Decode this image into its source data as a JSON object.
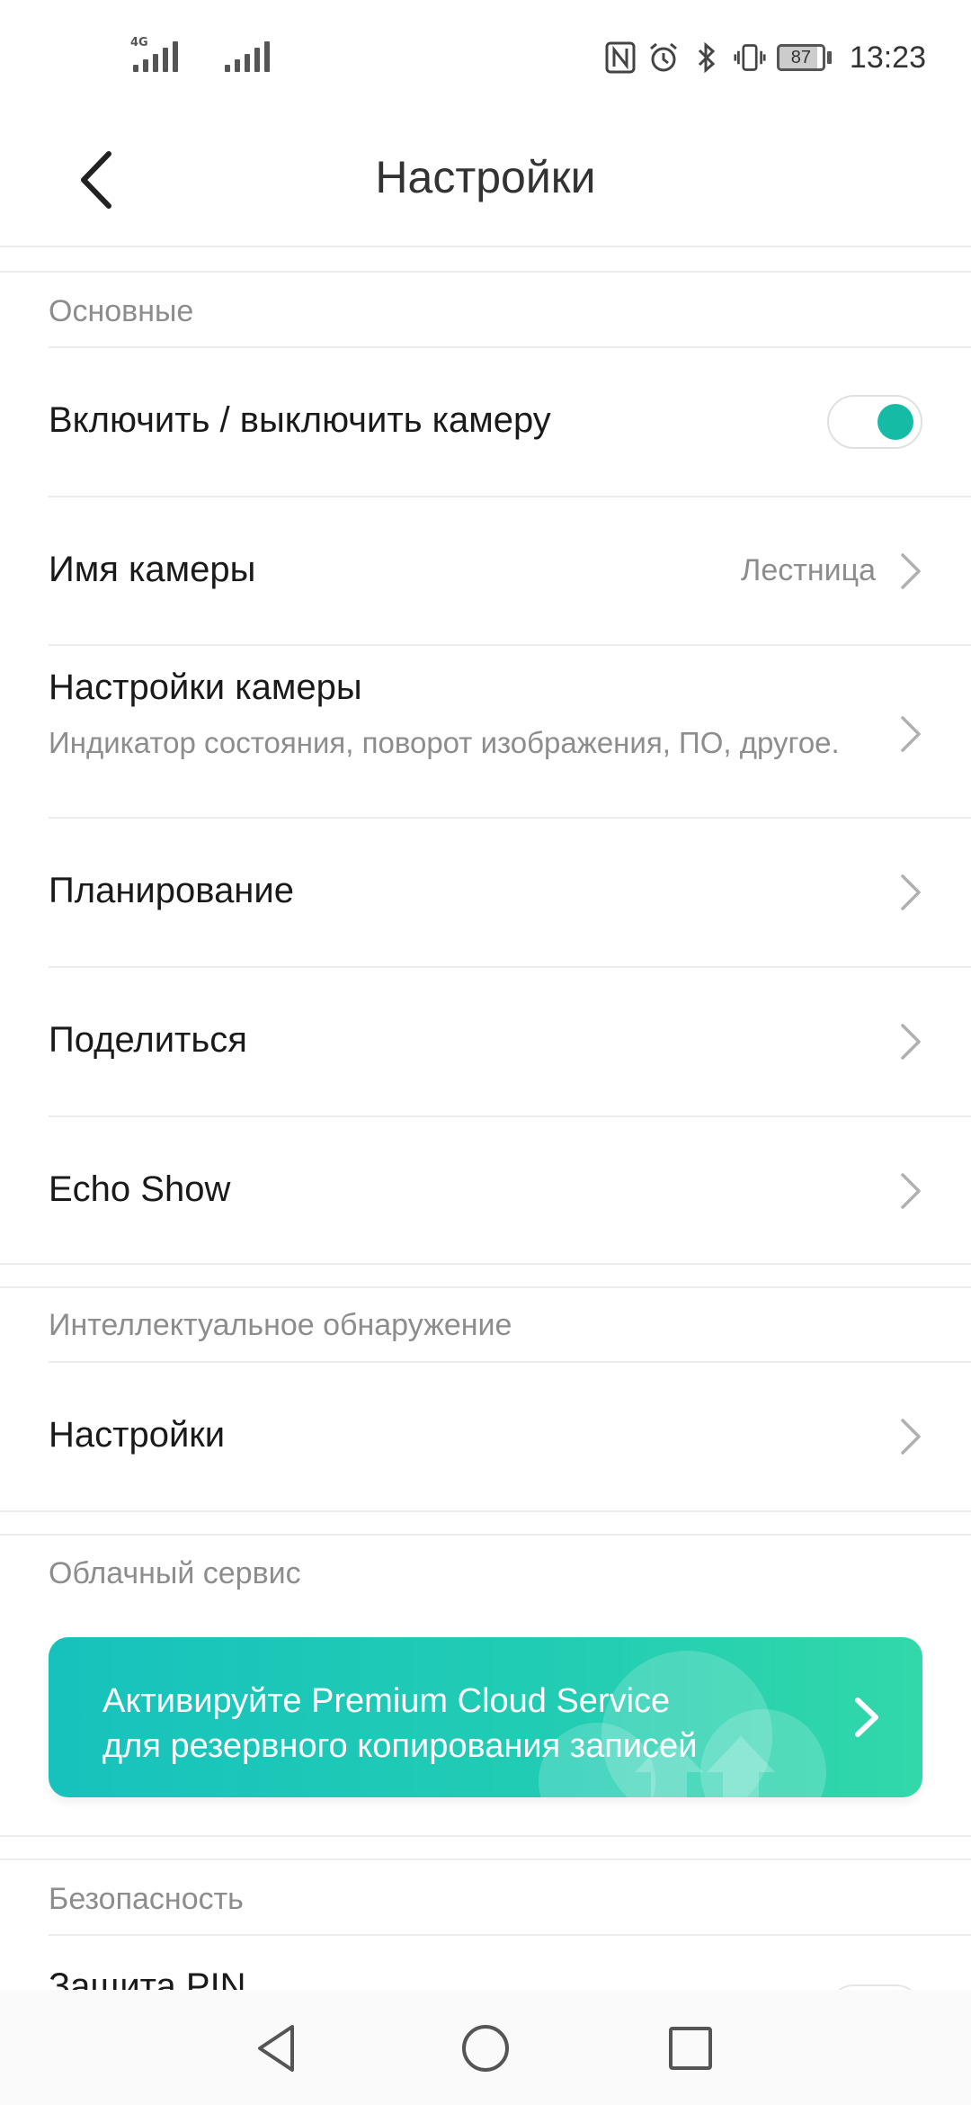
{
  "status_bar": {
    "network_label": "4G",
    "battery": "87",
    "time": "13:23",
    "icons": [
      "nfc-icon",
      "alarm-icon",
      "bluetooth-icon",
      "vibrate-icon"
    ]
  },
  "header": {
    "title": "Настройки"
  },
  "sections": {
    "basic": {
      "label": "Основные",
      "camera_toggle": {
        "label": "Включить / выключить камеру",
        "on": true
      },
      "camera_name": {
        "label": "Имя камеры",
        "value": "Лестница"
      },
      "camera_settings": {
        "label": "Настройки камеры",
        "subtitle": "Индикатор состояния, поворот изображения, ПО, другое."
      },
      "schedule": {
        "label": "Планирование"
      },
      "share": {
        "label": "Поделиться"
      },
      "echo_show": {
        "label": "Echo Show"
      }
    },
    "smart_detection": {
      "label": "Интеллектуальное обнаружение",
      "settings": {
        "label": "Настройки"
      }
    },
    "cloud": {
      "label": "Облачный сервис",
      "banner_line1": "Активируйте Premium Cloud Service",
      "banner_line2": "для резервного копирования записей"
    },
    "security": {
      "label": "Безопасность",
      "pin": {
        "label": "Защита PIN"
      }
    }
  },
  "colors": {
    "accent": "#16bba6",
    "banner_start": "#17c2bd",
    "banner_end": "#32d8a9",
    "secondary_text": "#8d8d8d"
  }
}
